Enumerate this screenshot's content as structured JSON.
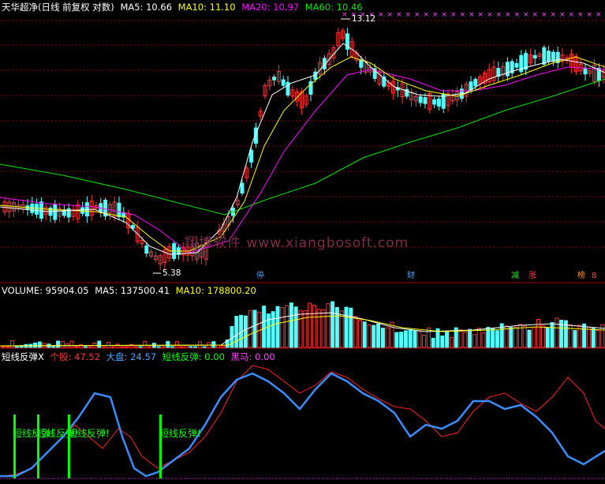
{
  "price": {
    "title": "天华超净(日线 前复权 对数)",
    "ma5": "MA5: 10.66",
    "ma10": "MA10: 11.10",
    "ma20": "MA20: 10.97",
    "ma60": "MA60: 10.46",
    "high_label": "13.12",
    "low_label": "5.38",
    "watermark": "翔博软件 www.xiangbosoft.com",
    "markers": [
      "停",
      "财",
      "减",
      "涨",
      "榜"
    ],
    "marker_extra": "8",
    "colors": {
      "up": "#ff3232",
      "down": "#54ffff",
      "ma5": "#ffffff",
      "ma10": "#ffff00",
      "ma20": "#ff00ff",
      "ma60": "#00e600"
    }
  },
  "volume": {
    "title": "VOLUME: 95904.05",
    "ma5": "MA5: 137500.41",
    "ma10": "MA10: 178800.20"
  },
  "indicator": {
    "title": "短线反弹X",
    "stock": "个股: 47.52",
    "market": "大盘: 24.57",
    "rebound": "短线反弹: 0.00",
    "darkhorse": "黑马: 0.00",
    "signal": "短线反弹!"
  }
}
